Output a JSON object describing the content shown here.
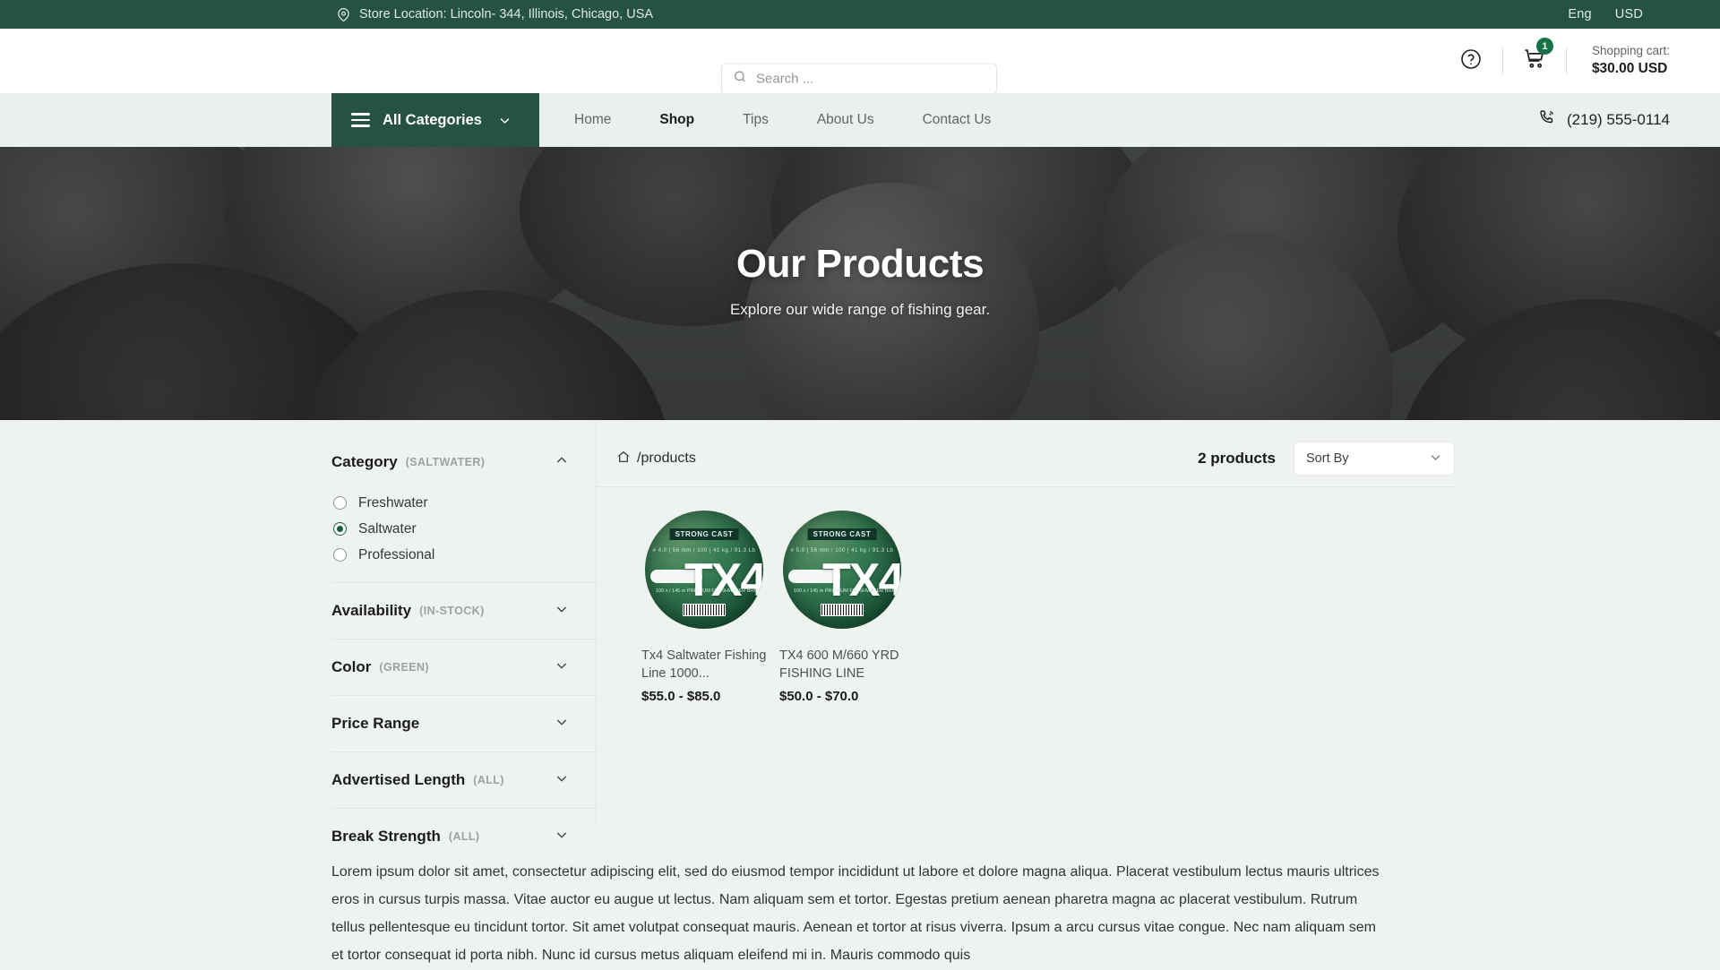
{
  "topbar": {
    "location_icon": "map-pin-icon",
    "location": "Store Location: Lincoln- 344, Illinois, Chicago, USA",
    "language": "Eng",
    "currency": "USD"
  },
  "header": {
    "search_placeholder": "Search ...",
    "search_value": "",
    "search_icon": "search-icon",
    "help_icon": "help-circle-icon",
    "cart_icon": "shopping-cart-icon",
    "cart_badge": "1",
    "cart_label": "Shopping cart:",
    "cart_amount": "$30.00 USD"
  },
  "nav": {
    "all_categories": "All Categories",
    "menu_icon": "hamburger-icon",
    "dropdown_icon": "chevron-down-icon",
    "links": [
      {
        "label": "Home",
        "active": false
      },
      {
        "label": "Shop",
        "active": true
      },
      {
        "label": "Tips",
        "active": false
      },
      {
        "label": "About Us",
        "active": false
      },
      {
        "label": "Contact Us",
        "active": false
      }
    ],
    "phone_icon": "phone-icon",
    "phone": "(219) 555-0114"
  },
  "hero": {
    "title": "Our Products",
    "subtitle": "Explore our wide range of fishing gear."
  },
  "filters": [
    {
      "title": "Category",
      "value": "(SALTWATER)",
      "expanded": true,
      "options": [
        {
          "label": "Freshwater",
          "selected": false
        },
        {
          "label": "Saltwater",
          "selected": true
        },
        {
          "label": "Professional",
          "selected": false
        }
      ]
    },
    {
      "title": "Availability",
      "value": "(IN-STOCK)",
      "expanded": false,
      "options": []
    },
    {
      "title": "Color",
      "value": "(GREEN)",
      "expanded": false,
      "options": []
    },
    {
      "title": "Price Range",
      "value": "",
      "expanded": false,
      "options": []
    },
    {
      "title": "Advertised Length",
      "value": "(ALL)",
      "expanded": false,
      "options": []
    },
    {
      "title": "Break Strength",
      "value": "(ALL)",
      "expanded": false,
      "options": []
    }
  ],
  "toolbar": {
    "home_icon": "home-icon",
    "breadcrumb": "/products",
    "product_count": "2 products",
    "sort_label": "Sort By",
    "sort_icon": "chevron-down-icon"
  },
  "products": [
    {
      "title": "Tx4 Saltwater Fishing Line 1000...",
      "price": "$55.0 - $85.0",
      "image_brand": "STRONG CAST",
      "image_model": "TX4",
      "image_specs": "# 4.0   |   56 mm / 100   |   41 kg / 91.3 Lb",
      "image_sub": "100 x / 145 m  PREMIUM  FRESHWATER BRAIDED LINE"
    },
    {
      "title": "TX4 600 M/660 YRD FISHING LINE",
      "price": "$50.0 - $70.0",
      "image_brand": "STRONG CAST",
      "image_model": "TX4",
      "image_specs": "# 5.0   |   56 mm / 100   |   41 kg / 91.3 Lb",
      "image_sub": "100 x / 145 m  PREMIUM  FRESHWATER BRAIDED LINE"
    }
  ],
  "footer": {
    "body": "Lorem ipsum dolor sit amet, consectetur adipiscing elit, sed do eiusmod tempor incididunt ut labore et dolore magna aliqua. Placerat vestibulum lectus mauris ultrices eros in cursus turpis massa. Vitae auctor eu augue ut lectus. Nam aliquam sem et tortor. Egestas pretium aenean pharetra magna ac placerat vestibulum. Rutrum tellus pellentesque eu tincidunt tortor. Sit amet volutpat consequat mauris. Aenean et tortor at risus viverra. Ipsum a arcu cursus vitae congue. Nec nam aliquam sem et tortor consequat id porta nibh. Nunc id cursus metus aliquam eleifend mi in. Mauris commodo quis"
  },
  "colors": {
    "brand_dark_green": "#255243",
    "nav_bg": "#eaf0ed",
    "page_bg": "#eef3f0",
    "badge_green": "#157347",
    "radio_green": "#1d5c41"
  }
}
